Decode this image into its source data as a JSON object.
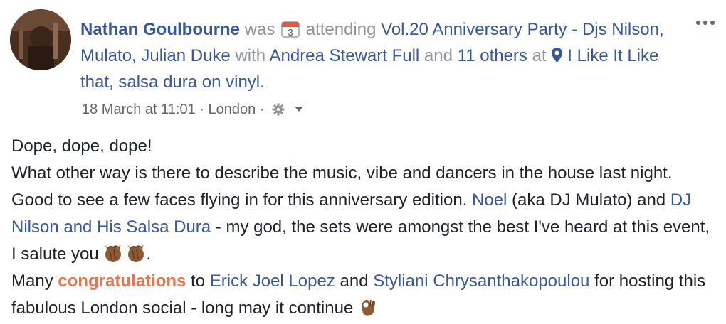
{
  "post": {
    "author": "Nathan Goulbourne",
    "was": "was",
    "calendar_day": "3",
    "attending": "attending",
    "event": "Vol.20 Anniversary Party - Djs Nilson, Mulato, Julian Duke",
    "with": "with",
    "friend": "Andrea Stewart Full",
    "and": "and",
    "others": "11 others",
    "at": "at",
    "place": "I Like It Like that, salsa dura on vinyl.",
    "date": "18 March at 11:01",
    "sep1": "·",
    "location": "London",
    "sep2": "·"
  },
  "body": {
    "line1": "Dope, dope, dope!",
    "p2_a": "What other way is there to describe the music, vibe and dancers in the house last night. Good to see a few faces flying in for this anniversary edition. ",
    "mention_noel": "Noel",
    "p2_b": " (aka DJ Mulato) and ",
    "mention_nilson": "DJ Nilson and His Salsa Dura",
    "p2_c": " - my god, the sets were amongst the best I've heard at this event, I salute you ",
    "p2_d": ".",
    "p3_a": "Many ",
    "congrats": "congratulations",
    "p3_b": " to ",
    "mention_erick": "Erick Joel Lopez",
    "p3_c": " and ",
    "mention_styliani": "Styliani Chrysanthakopoulou",
    "p3_d": " for hosting this fabulous London social - long may it continue "
  },
  "icons": {
    "more": "more-options-icon",
    "calendar": "calendar-icon",
    "pin": "location-pin-icon",
    "audience": "gear-icon",
    "caret": "chevron-down-icon",
    "clap": "clapping-hands-emoji",
    "ok": "ok-hand-emoji"
  },
  "colors": {
    "link": "#385898",
    "muted": "#90949c",
    "text": "#1d2129",
    "accent": "#e27552"
  }
}
